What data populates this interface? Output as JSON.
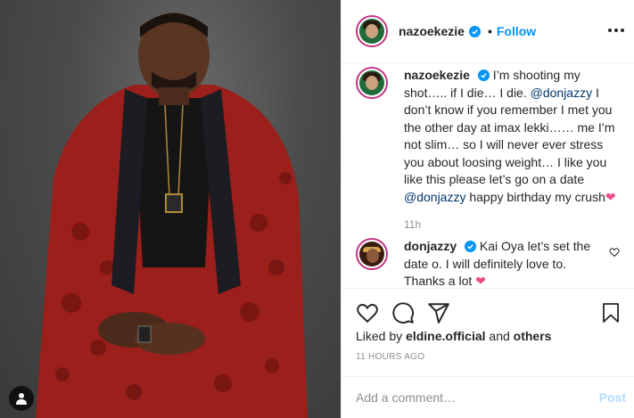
{
  "post": {
    "author": "nazoekezie",
    "follow_label": "Follow",
    "separator": "•"
  },
  "caption": {
    "username": "nazoekezie",
    "text_part1": "I’m shooting my shot….. if I die… I die. ",
    "mention1": "@donjazzy",
    "text_part2": " I don’t know if you remember I met you the other day at imax lekki…… me I’m not slim… so I will never ever stress you about loosing weight… I like you like this please let’s go on a date ",
    "mention2": "@donjazzy",
    "text_part3": " happy birthday my crush",
    "heart": "❤",
    "time": "11h"
  },
  "reply": {
    "username": "donjazzy",
    "text": "Kai Oya let’s set the date o. I will definitely love to. Thanks a lot ",
    "heart": "❤"
  },
  "likes": {
    "prefix": "Liked by ",
    "user": "eldine.official",
    "and": " and ",
    "others": "others"
  },
  "timestamp": "11 HOURS AGO",
  "comment_box": {
    "placeholder": "Add a comment…",
    "post_label": "Post"
  },
  "colors": {
    "accent": "#0095f6",
    "post_disabled": "#b3dbff",
    "mention": "#00376b",
    "heart": "#ed4c8a",
    "ring": "#c13584"
  },
  "icons": [
    "verified-badge-icon",
    "more-options-icon",
    "heart-icon",
    "comment-icon",
    "share-icon",
    "bookmark-icon",
    "user-tag-icon"
  ]
}
